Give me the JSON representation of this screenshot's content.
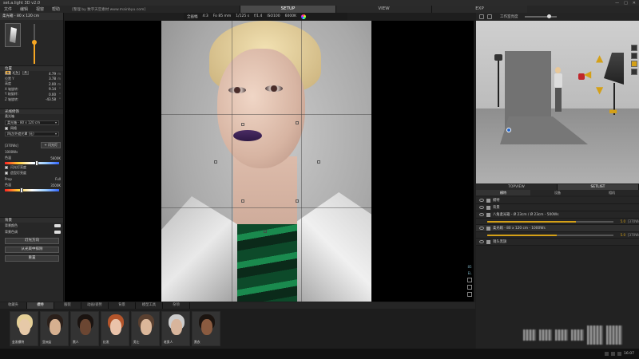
{
  "window": {
    "title": "set.a.light 3D v2.0",
    "minimize": "—",
    "maximize": "□",
    "close": "✕"
  },
  "menu": {
    "items": [
      "文件",
      "编辑",
      "视窗",
      "帮助"
    ],
    "url": "[整理 by 数字天空素材 www.mainbyu.com]"
  },
  "top_tabs": [
    {
      "label": "SETUP",
      "active": true
    },
    {
      "label": "VIEW",
      "active": false
    },
    {
      "label": "EXP",
      "active": false
    }
  ],
  "camera_bar": {
    "format": "全画幅",
    "ratio": "4:3",
    "focal": "Fo 85 mm",
    "shutter": "1/125 s",
    "aperture": "f/1.4",
    "iso": "ISO100",
    "wb": "6000K"
  },
  "right_toolbar": {
    "label": "工作室亮度"
  },
  "left_panel": {
    "header": "柔光箱 - 80 x 120 cm",
    "light_value": "5.0",
    "light_level": 0.55,
    "mode_labels": [
      "◉",
      "S",
      "A"
    ],
    "position": {
      "title": "位置",
      "rows": [
        {
          "label": "位置 X",
          "value": "4.79",
          "unit": "m"
        },
        {
          "label": "位置 Y",
          "value": "3.78",
          "unit": "m"
        },
        {
          "label": "高度",
          "value": "2.00",
          "unit": "m"
        },
        {
          "label": "X 轴旋转:",
          "value": "9.14",
          "unit": "°"
        },
        {
          "label": "Y 轴旋转:",
          "value": "0.00",
          "unit": "°"
        },
        {
          "label": "Z 轴旋转:",
          "value": "-43.58",
          "unit": "°"
        }
      ]
    },
    "modifier": {
      "title": "光线修饰",
      "type_label": "柔光箱",
      "type_value": "柔光箱 - 80 x 120 cm",
      "grid_label": "网格",
      "grid_value": "四边/外遮光罩 (无)"
    },
    "power": {
      "model": "[370Ws]",
      "add_button": "+ 闪光灯",
      "value": "1000Ws"
    },
    "temperature": {
      "label": "色温",
      "value": "5600K",
      "knob": 0.6
    },
    "checks": [
      {
        "label": "闪光灯亮度"
      },
      {
        "label": "造型灯亮度"
      }
    ],
    "prop_row": {
      "left": "Prop",
      "right": "Full"
    },
    "temp2": {
      "label": "色温",
      "value": "3500K",
      "knob": 0.3
    },
    "background": {
      "title": "背景",
      "row1": "背景颜色",
      "row2": "背景色调"
    },
    "buttons": [
      "灯光方向",
      "从光束中排除",
      "重置"
    ]
  },
  "viewport_side": {
    "label1": "85",
    "label2": "EL"
  },
  "right_panel": {
    "tabs": [
      {
        "label": "TOPVIEW",
        "active": false
      },
      {
        "label": "SETLIST",
        "active": true
      }
    ],
    "subtabs": [
      {
        "label": "模特",
        "active": true
      },
      {
        "label": "设备",
        "active": false
      },
      {
        "label": "相机",
        "active": false
      }
    ],
    "lights": [
      {
        "name": "模特",
        "kind": "row"
      },
      {
        "name": "背景",
        "kind": "row"
      },
      {
        "name": "八角柔光箱 - Ø 23cm / Ø 23cm - 500Ws",
        "kind": "row"
      },
      {
        "kind": "slider",
        "value": "5.0",
        "unit": "[370Ws]",
        "fill": 0.7
      },
      {
        "name": "柔光箱 - 80 x 120 cm - 1000Ws",
        "kind": "row",
        "selected": true
      },
      {
        "kind": "slider",
        "value": "5.0",
        "unit": "[370Ws]",
        "fill": 0.55
      },
      {
        "name": "镜头黑旗",
        "kind": "row"
      }
    ]
  },
  "bottom_tabs": [
    {
      "label": "收藏夹",
      "active": false
    },
    {
      "label": "模特",
      "active": true
    },
    {
      "label": "服装",
      "active": false
    },
    {
      "label": "动画/姿势",
      "active": false
    },
    {
      "label": "背景",
      "active": false
    },
    {
      "label": "模型工具",
      "active": false
    },
    {
      "label": "杂项",
      "active": false
    }
  ],
  "models": [
    {
      "name": "金发模特",
      "skin": "#e6c9a8",
      "hair": "#e4cf96"
    },
    {
      "name": "亚洲女",
      "skin": "#d6b090",
      "hair": "#2a1f1a"
    },
    {
      "name": "黑人",
      "skin": "#6b4632",
      "hair": "#1a1310"
    },
    {
      "name": "红发",
      "skin": "#eac3aa",
      "hair": "#b4552b"
    },
    {
      "name": "男士",
      "skin": "#dbb79a",
      "hair": "#5a4030"
    },
    {
      "name": "老男人",
      "skin": "#d8b59c",
      "hair": "#cccccc"
    },
    {
      "name": "黑衣",
      "skin": "#8a5b40",
      "hair": "#1b1410"
    }
  ],
  "taskbar": {
    "time": "16:07"
  },
  "colors": {
    "accent": "#d4a017",
    "lipstick": "#4a2c63",
    "shirt_green": "#1a8a4e"
  }
}
